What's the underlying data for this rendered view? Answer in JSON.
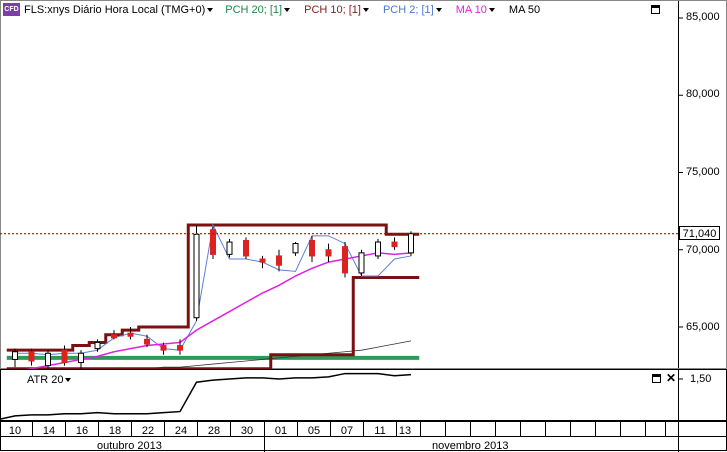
{
  "header": {
    "cfd_badge": "CFD",
    "symbol_label": "FLS:xnys Diário Hora Local (TMG+0)",
    "indicators": [
      {
        "label": "PCH 20; [1]",
        "color": "#1a8a4a"
      },
      {
        "label": "PCH 10; [1]",
        "color": "#8b1a1a"
      },
      {
        "label": "PCH 2; [1]",
        "color": "#4a78d6"
      },
      {
        "label": "MA 10",
        "color": "#e020e0"
      },
      {
        "label": "MA 50",
        "color": "#000000"
      }
    ]
  },
  "price_axis": {
    "labels": [
      "85,000",
      "80,000",
      "75,000",
      "70,000",
      "65,000"
    ],
    "current_price": "71,040"
  },
  "atr_panel": {
    "label": "ATR 20",
    "axis_label": "1,50"
  },
  "time_axis": {
    "days": [
      "10",
      "14",
      "16",
      "18",
      "22",
      "24",
      "28",
      "30",
      "01",
      "05",
      "07",
      "11",
      "13"
    ],
    "months": [
      "outubro 2013",
      "novembro 2013"
    ]
  },
  "colors": {
    "up_candle": "#ffffff",
    "down_candle": "#dd2222",
    "pch20": "#2e9a5a",
    "pch10": "#7a1010",
    "pch2": "#5a82d8",
    "ma10": "#e020e0",
    "ma50": "#333333",
    "price_line": "#cc0000"
  },
  "chart_data": {
    "type": "line",
    "title": "FLS:xnys Diário Hora Local (TMG+0)",
    "x": [
      "10",
      "11",
      "14",
      "15",
      "16",
      "17",
      "18",
      "21",
      "22",
      "23",
      "24",
      "25",
      "28",
      "29",
      "30",
      "31",
      "01",
      "04",
      "05",
      "06",
      "07",
      "08",
      "11",
      "12",
      "13"
    ],
    "ylim": [
      62.7,
      87.0
    ],
    "candles": [
      {
        "o": 62.9,
        "h": 63.6,
        "l": 62.4,
        "c": 63.4
      },
      {
        "o": 63.4,
        "h": 63.6,
        "l": 62.5,
        "c": 62.8
      },
      {
        "o": 62.5,
        "h": 63.5,
        "l": 62.3,
        "c": 63.3
      },
      {
        "o": 63.5,
        "h": 63.8,
        "l": 62.5,
        "c": 62.7
      },
      {
        "o": 62.7,
        "h": 63.5,
        "l": 62.3,
        "c": 63.3
      },
      {
        "o": 63.6,
        "h": 64.2,
        "l": 63.4,
        "c": 64.0
      },
      {
        "o": 64.5,
        "h": 64.8,
        "l": 64.2,
        "c": 64.3
      },
      {
        "o": 64.6,
        "h": 65.0,
        "l": 64.2,
        "c": 64.4
      },
      {
        "o": 64.2,
        "h": 64.5,
        "l": 63.7,
        "c": 63.9
      },
      {
        "o": 63.8,
        "h": 64.0,
        "l": 63.2,
        "c": 63.5
      },
      {
        "o": 63.8,
        "h": 64.2,
        "l": 63.2,
        "c": 63.5
      },
      {
        "o": 65.6,
        "h": 71.6,
        "l": 65.4,
        "c": 71.0
      },
      {
        "o": 71.3,
        "h": 71.5,
        "l": 69.4,
        "c": 69.7
      },
      {
        "o": 69.7,
        "h": 70.7,
        "l": 69.5,
        "c": 70.5
      },
      {
        "o": 70.6,
        "h": 70.8,
        "l": 69.4,
        "c": 69.6
      },
      {
        "o": 69.4,
        "h": 69.6,
        "l": 68.8,
        "c": 69.2
      },
      {
        "o": 69.6,
        "h": 70.0,
        "l": 68.6,
        "c": 69.0
      },
      {
        "o": 69.8,
        "h": 70.5,
        "l": 69.6,
        "c": 70.4
      },
      {
        "o": 70.6,
        "h": 70.9,
        "l": 69.2,
        "c": 69.6
      },
      {
        "o": 70.0,
        "h": 70.4,
        "l": 69.2,
        "c": 69.6
      },
      {
        "o": 70.2,
        "h": 70.5,
        "l": 68.2,
        "c": 68.5
      },
      {
        "o": 68.5,
        "h": 70.0,
        "l": 68.3,
        "c": 69.8
      },
      {
        "o": 69.6,
        "h": 70.7,
        "l": 69.4,
        "c": 70.5
      },
      {
        "o": 70.5,
        "h": 70.8,
        "l": 70.0,
        "c": 70.2
      },
      {
        "o": 69.8,
        "h": 71.2,
        "l": 69.6,
        "c": 71.04
      }
    ],
    "series": [
      {
        "name": "PCH 20; [1]",
        "upper": [
          63.0,
          63.0,
          63.0,
          63.0,
          63.0,
          63.0,
          63.0,
          63.0,
          63.0,
          63.0,
          63.0,
          63.0,
          63.0,
          63.0,
          63.0,
          63.0,
          63.0,
          63.0,
          63.0,
          63.0,
          63.0,
          63.0,
          63.0,
          63.0,
          63.0
        ],
        "lower": [
          62.9,
          62.9,
          62.9,
          62.9,
          62.9,
          62.9,
          62.9,
          62.9,
          62.9,
          62.9,
          62.9,
          62.9,
          62.9,
          62.9,
          62.9,
          62.9,
          62.9,
          62.9,
          62.9,
          62.9,
          62.9,
          62.9,
          62.9,
          62.9,
          62.9
        ]
      },
      {
        "name": "PCH 10; [1]",
        "upper": [
          63.5,
          63.5,
          63.5,
          63.5,
          63.8,
          64.0,
          64.5,
          64.8,
          65.0,
          65.0,
          65.0,
          71.6,
          71.6,
          71.6,
          71.6,
          71.6,
          71.6,
          71.6,
          71.6,
          71.6,
          71.6,
          71.6,
          71.6,
          71.0,
          71.0
        ],
        "lower": [
          62.3,
          62.3,
          62.3,
          62.3,
          62.3,
          62.3,
          62.3,
          62.3,
          62.3,
          62.3,
          62.3,
          62.3,
          62.3,
          62.3,
          62.3,
          62.3,
          63.2,
          63.2,
          63.2,
          63.2,
          63.2,
          68.2,
          68.2,
          68.2,
          68.2
        ]
      },
      {
        "name": "PCH 2; [1]",
        "values": [
          63.3,
          63.3,
          63.2,
          63.3,
          63.3,
          63.5,
          64.3,
          64.6,
          64.4,
          63.6,
          63.5,
          65.4,
          71.6,
          69.4,
          69.4,
          69.2,
          68.7,
          68.6,
          70.9,
          70.9,
          70.4,
          68.3,
          68.3,
          69.4,
          69.6
        ]
      },
      {
        "name": "MA 10",
        "values": [
          62.1,
          62.3,
          62.5,
          62.7,
          62.9,
          63.1,
          63.4,
          63.6,
          63.8,
          63.9,
          64.0,
          64.8,
          65.4,
          66.0,
          66.6,
          67.2,
          67.7,
          68.3,
          68.8,
          69.2,
          69.4,
          69.6,
          69.8,
          69.7,
          69.8
        ]
      },
      {
        "name": "MA 50",
        "values": [
          62.0,
          62.0,
          62.0,
          62.0,
          62.0,
          62.1,
          62.2,
          62.2,
          62.3,
          62.4,
          62.4,
          62.5,
          62.6,
          62.7,
          62.8,
          62.9,
          63.0,
          63.1,
          63.2,
          63.3,
          63.4,
          63.5,
          63.7,
          63.9,
          64.1
        ]
      }
    ],
    "atr": {
      "name": "ATR 20",
      "values": [
        1.16,
        1.17,
        1.17,
        1.18,
        1.18,
        1.19,
        1.18,
        1.18,
        1.18,
        1.19,
        1.2,
        1.47,
        1.49,
        1.5,
        1.51,
        1.51,
        1.5,
        1.51,
        1.51,
        1.52,
        1.55,
        1.55,
        1.55,
        1.53,
        1.54
      ]
    },
    "current_price": 71.04
  }
}
